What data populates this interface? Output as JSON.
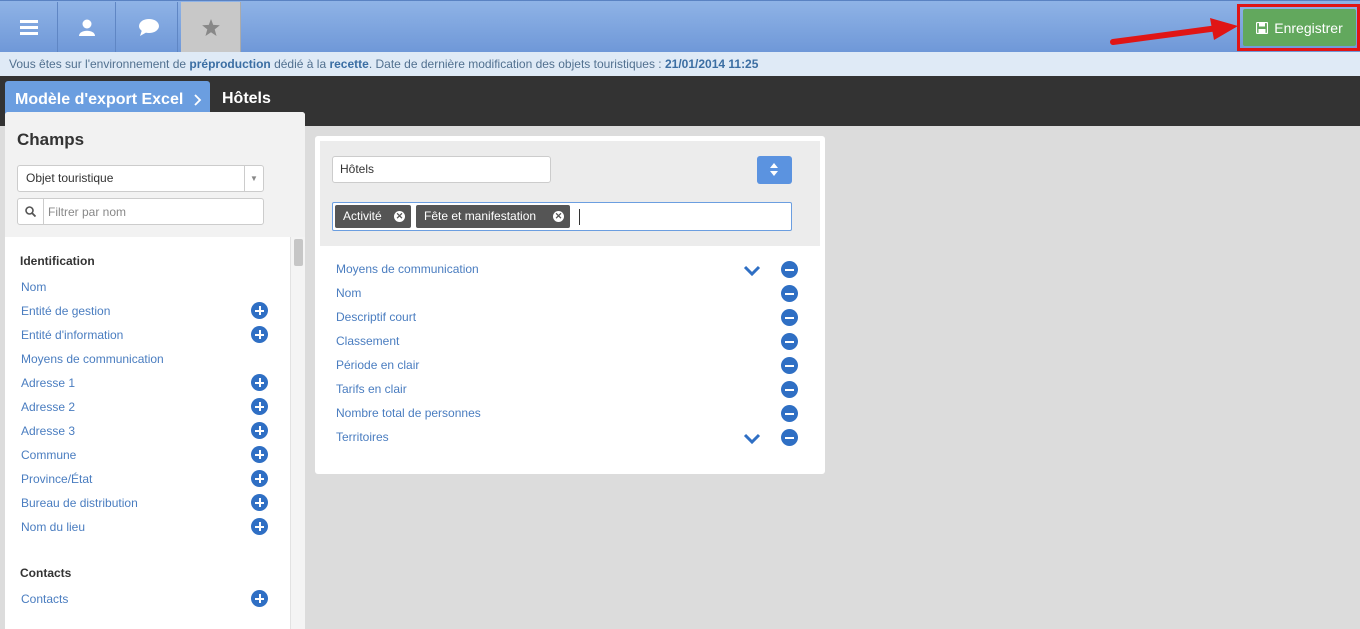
{
  "app": {
    "nav": [
      {
        "icon": "menu-icon"
      },
      {
        "icon": "user-icon"
      },
      {
        "icon": "chat-icon"
      },
      {
        "icon": "star-icon"
      }
    ],
    "save_label": "Enregistrer",
    "save_icon": "floppy-disk-icon",
    "accent_color": "#6b9ee0",
    "save_color": "#62a85d",
    "highlight_color": "#e01515"
  },
  "info": {
    "prefix": "Vous êtes sur l'environnement de ",
    "env": "préproduction",
    "middle": " dédié à la ",
    "purpose": "recette",
    "suffix": ". Date de dernière modification des objets touristiques : ",
    "date": "21/01/2014 11:25"
  },
  "breadcrumb": {
    "parent": "Modèle d'export Excel",
    "current": "Hôtels"
  },
  "fields_panel": {
    "title": "Champs",
    "select_value": "Objet touristique",
    "filter_placeholder": "Filtrer par nom",
    "sections": [
      {
        "title": "Identification",
        "items": [
          {
            "label": "Nom",
            "addable": false
          },
          {
            "label": "Entité de gestion",
            "addable": true
          },
          {
            "label": "Entité d'information",
            "addable": true
          },
          {
            "label": "Moyens de communication",
            "addable": false
          },
          {
            "label": "Adresse 1",
            "addable": true
          },
          {
            "label": "Adresse 2",
            "addable": true
          },
          {
            "label": "Adresse 3",
            "addable": true
          },
          {
            "label": "Commune",
            "addable": true
          },
          {
            "label": "Province/État",
            "addable": true
          },
          {
            "label": "Bureau de distribution",
            "addable": true
          },
          {
            "label": "Nom du lieu",
            "addable": true
          }
        ]
      },
      {
        "title": "Contacts",
        "items": [
          {
            "label": "Contacts",
            "addable": true
          }
        ]
      }
    ]
  },
  "export": {
    "name_value": "Hôtels",
    "tags": [
      "Activité",
      "Fête et manifestation"
    ],
    "selected_fields": [
      {
        "label": "Moyens de communication",
        "expandable": true
      },
      {
        "label": "Nom",
        "expandable": false
      },
      {
        "label": "Descriptif court",
        "expandable": false
      },
      {
        "label": "Classement",
        "expandable": false
      },
      {
        "label": "Période en clair",
        "expandable": false
      },
      {
        "label": "Tarifs en clair",
        "expandable": false
      },
      {
        "label": "Nombre total de personnes",
        "expandable": false
      },
      {
        "label": "Territoires",
        "expandable": true
      }
    ]
  }
}
